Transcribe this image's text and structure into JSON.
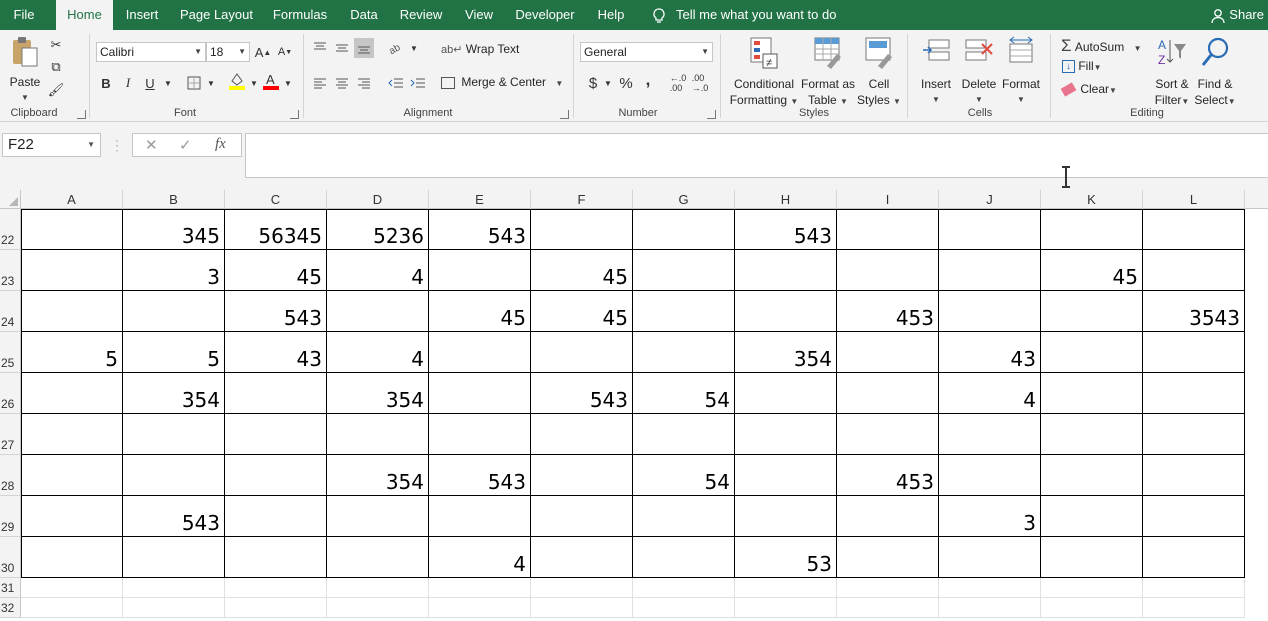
{
  "menu": {
    "tabs": [
      "File",
      "Home",
      "Insert",
      "Page Layout",
      "Formulas",
      "Data",
      "Review",
      "View",
      "Developer",
      "Help"
    ],
    "active": "Home",
    "tell_me": "Tell me what you want to do",
    "share": "Share"
  },
  "ribbon": {
    "clipboard": {
      "label": "Clipboard",
      "paste": "Paste"
    },
    "font": {
      "label": "Font",
      "name": "Calibri",
      "size": "18",
      "bold": "B",
      "italic": "I",
      "underline": "U"
    },
    "alignment": {
      "label": "Alignment",
      "wrap_text": "Wrap Text",
      "merge_center": "Merge & Center"
    },
    "number": {
      "label": "Number",
      "format": "General",
      "currency": "$",
      "percent": "%",
      "comma": ","
    },
    "styles": {
      "label": "Styles",
      "conditional": [
        "Conditional",
        "Formatting"
      ],
      "format_table": [
        "Format as",
        "Table"
      ],
      "cell_styles": [
        "Cell",
        "Styles"
      ]
    },
    "cells": {
      "label": "Cells",
      "insert": "Insert",
      "delete": "Delete",
      "format": "Format"
    },
    "editing": {
      "label": "Editing",
      "autosum": "AutoSum",
      "fill": "Fill",
      "clear": "Clear",
      "sort": [
        "Sort &",
        "Filter"
      ],
      "find": [
        "Find &",
        "Select"
      ]
    }
  },
  "formula_bar": {
    "name_box": "F22",
    "fx": "fx",
    "value": ""
  },
  "colors": {
    "brand": "#217346",
    "ribbon_bg": "#f3f3f3",
    "font_highlight": "#ffff00",
    "font_color": "#ff0000"
  },
  "columns": [
    "A",
    "B",
    "C",
    "D",
    "E",
    "F",
    "G",
    "H",
    "I",
    "J",
    "K",
    "L"
  ],
  "rows": [
    {
      "num": "22",
      "cells": [
        "",
        "345",
        "56345",
        "5236",
        "543",
        "",
        "",
        "543",
        "",
        "",
        "",
        ""
      ]
    },
    {
      "num": "23",
      "cells": [
        "",
        "3",
        "45",
        "4",
        "",
        "45",
        "",
        "",
        "",
        "",
        "45",
        ""
      ]
    },
    {
      "num": "24",
      "cells": [
        "",
        "",
        "543",
        "",
        "45",
        "45",
        "",
        "",
        "453",
        "",
        "",
        "3543"
      ]
    },
    {
      "num": "25",
      "cells": [
        "5",
        "5",
        "43",
        "4",
        "",
        "",
        "",
        "354",
        "",
        "43",
        "",
        ""
      ]
    },
    {
      "num": "26",
      "cells": [
        "",
        "354",
        "",
        "354",
        "",
        "543",
        "54",
        "",
        "",
        "4",
        "",
        ""
      ]
    },
    {
      "num": "27",
      "cells": [
        "",
        "",
        "",
        "",
        "",
        "",
        "",
        "",
        "",
        "",
        "",
        ""
      ]
    },
    {
      "num": "28",
      "cells": [
        "",
        "",
        "",
        "354",
        "543",
        "",
        "54",
        "",
        "453",
        "",
        "",
        ""
      ]
    },
    {
      "num": "29",
      "cells": [
        "",
        "543",
        "",
        "",
        "",
        "",
        "",
        "",
        "",
        "3",
        "",
        ""
      ]
    },
    {
      "num": "30",
      "cells": [
        "",
        "",
        "",
        "",
        "4",
        "",
        "",
        "53",
        "",
        "",
        "",
        ""
      ]
    },
    {
      "num": "31",
      "cells": [
        "",
        "",
        "",
        "",
        "",
        "",
        "",
        "",
        "",
        "",
        "",
        ""
      ]
    },
    {
      "num": "32",
      "cells": [
        "",
        "",
        "",
        "",
        "",
        "",
        "",
        "",
        "",
        "",
        "",
        ""
      ]
    }
  ]
}
